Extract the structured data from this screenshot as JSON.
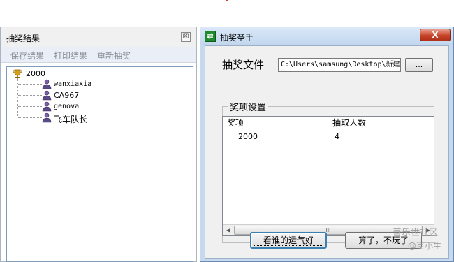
{
  "results_panel": {
    "title": "抽奖结果",
    "close_glyph": "☒",
    "toolbar": [
      "保存结果",
      "打印结果",
      "重新抽奖"
    ],
    "tree": {
      "root": {
        "label": "2000",
        "icon": "trophy-icon"
      },
      "children": [
        {
          "label": "wanxiaxia",
          "icon": "user-icon"
        },
        {
          "label": "CA967",
          "icon": "user-icon"
        },
        {
          "label": "genova",
          "icon": "user-icon"
        },
        {
          "label": "飞车队长",
          "icon": "user-icon"
        }
      ]
    }
  },
  "app_window": {
    "title": "抽奖圣手",
    "app_icon": "app-lottery-icon",
    "close_glyph": "X",
    "file_label": "抽奖文件",
    "file_path": "C:\\Users\\samsung\\Desktop\\新建",
    "browse_label": "...",
    "group_label": "奖项设置",
    "columns": [
      "奖项",
      "抽取人数"
    ],
    "rows": [
      {
        "prize": "2000",
        "count": "4"
      }
    ],
    "scroll_thumb_grip": "III",
    "lucky_button": "看谁的运气好",
    "quit_button": "算了，不玩了"
  },
  "watermark": {
    "line1": "善乐世社区",
    "line2": "@百小生"
  },
  "colors": {
    "title_bar_bg": "#c7d9ee",
    "close_button": "#c8432a",
    "toolbar_text": "#8a8f98"
  }
}
